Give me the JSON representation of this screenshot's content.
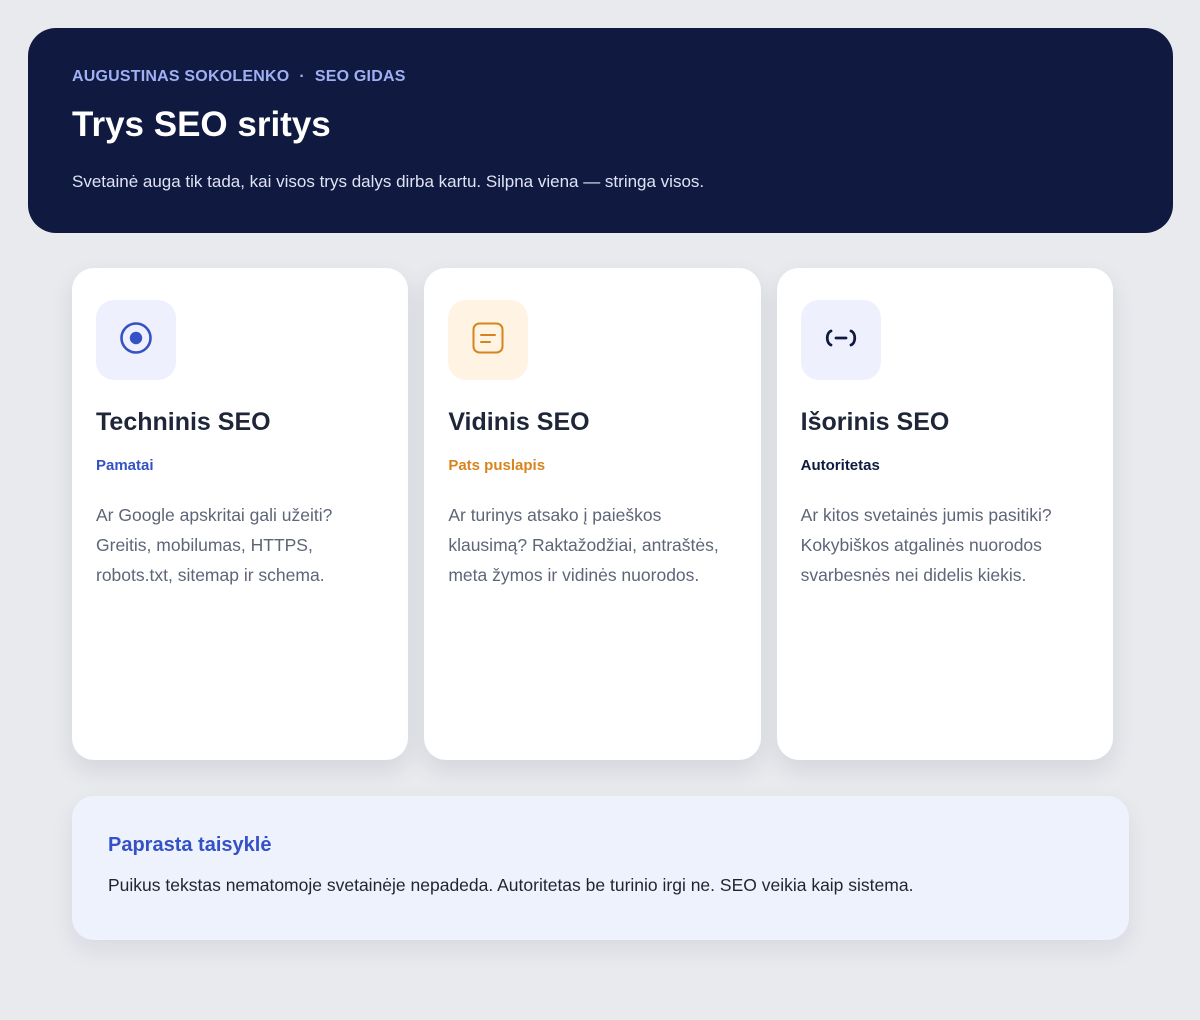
{
  "header": {
    "author": "AUGUSTINAS SOKOLENKO",
    "separator": "·",
    "section": "SEO GIDAS",
    "title": "Trys SEO sritys",
    "subtitle": "Svetainė auga tik tada, kai visos trys dalys dirba kartu. Silpna viena — stringa visos."
  },
  "cards": [
    {
      "icon": "target-icon",
      "title": "Techninis SEO",
      "tag": "Pamatai",
      "body": "Ar Google apskritai gali užeiti? Greitis, mobilumas, HTTPS, robots.txt, sitemap ir schema.",
      "accent": "#3451c6",
      "icon_bg": "#eef1fd"
    },
    {
      "icon": "document-icon",
      "title": "Vidinis SEO",
      "tag": "Pats puslapis",
      "body": "Ar turinys atsako į paieškos klausimą? Raktažodžiai, antraštės, meta žymos ir vidinės nuorodos.",
      "accent": "#d7841f",
      "icon_bg": "#fff3e4"
    },
    {
      "icon": "link-icon",
      "title": "Išorinis SEO",
      "tag": "Autoritetas",
      "body": "Ar kitos svetainės jumis pasitiki? Kokybiškos atgalinės nuorodos svarbesnės nei didelis kiekis.",
      "accent": "#101a40",
      "icon_bg": "#eef1fd"
    }
  ],
  "rule": {
    "title": "Paprasta taisyklė",
    "text": "Puikus tekstas nematomoje svetainėje nepadeda. Autoritetas be turinio irgi ne. SEO veikia kaip sistema."
  }
}
